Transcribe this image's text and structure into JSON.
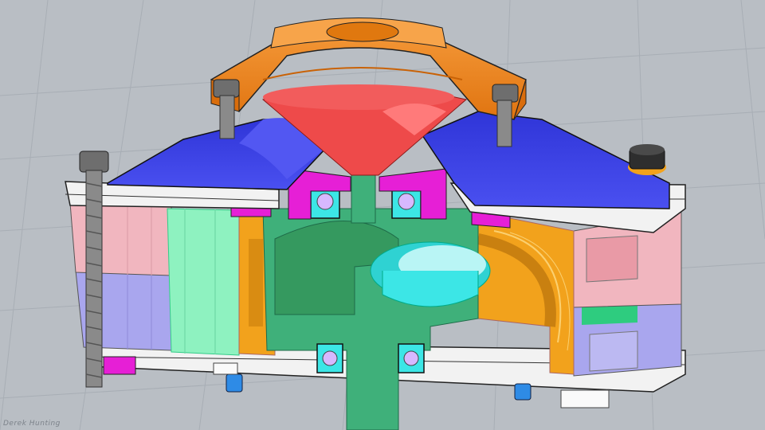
{
  "scene": {
    "description_label": "",
    "signature": "Derek Hunting",
    "colors": {
      "background": "#b9bec4",
      "grid_line": "#a7adb4",
      "orange_cap": "#f0821e",
      "red_cone": "#ee4a4a",
      "blue_plate": "#3b3fe6",
      "magenta": "#e61fd6",
      "green_shaft": "#3fb07a",
      "mint_block": "#8ef2c0",
      "yellow_housing": "#f2a21c",
      "cyan_parts": "#3ce6e6",
      "pink_block": "#f1b6bf",
      "lavender_block": "#a9a6ee",
      "gray_bolt": "#6e6e6e",
      "white_plate": "#f4f4f4",
      "light_blue_nut": "#2e8be6"
    }
  }
}
